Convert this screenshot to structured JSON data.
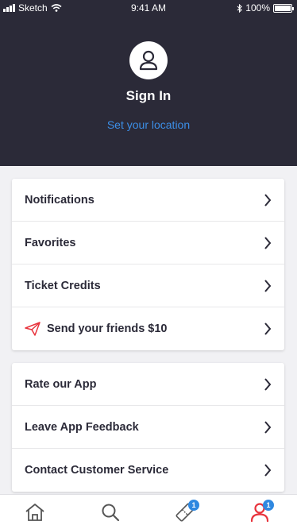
{
  "status_bar": {
    "carrier": "Sketch",
    "time": "9:41 AM",
    "battery": "100%"
  },
  "header": {
    "title": "Sign In",
    "location_link": "Set your location"
  },
  "menu_group_1": [
    {
      "label": "Notifications"
    },
    {
      "label": "Favorites"
    },
    {
      "label": "Ticket Credits"
    },
    {
      "label": "Send your friends $10",
      "icon": "paper-plane-icon"
    }
  ],
  "menu_group_2": [
    {
      "label": "Rate our App"
    },
    {
      "label": "Leave App Feedback"
    },
    {
      "label": "Contact Customer Service"
    }
  ],
  "tab_bar": {
    "tickets_badge": "1",
    "account_badge": "1"
  },
  "colors": {
    "header_bg": "#2b2a38",
    "accent": "#3c8ee6",
    "active_tab": "#e8333c",
    "badge": "#2f88e0"
  }
}
